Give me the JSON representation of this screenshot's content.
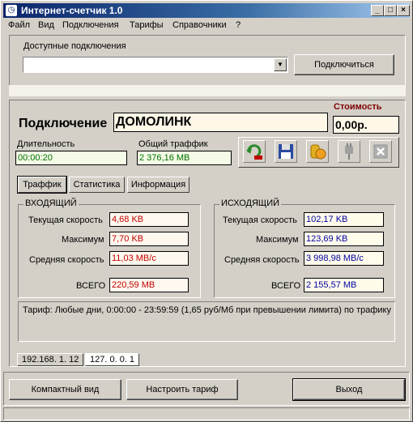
{
  "window": {
    "title": "Интернет-счетчик 1.0",
    "minimize": "_",
    "maximize": "□",
    "close": "×"
  },
  "menu": [
    "Файл",
    "Вид",
    "Подключения",
    "Тарифы",
    "Справочники",
    "?"
  ],
  "connections": {
    "label": "Доступные подключения",
    "selected": "",
    "connect_button": "Подключиться"
  },
  "connection": {
    "label": "Подключение",
    "name": "ДОМОЛИНК",
    "cost_label": "Стоимость",
    "cost_value": "0,00р.",
    "duration_label": "Длительность",
    "duration_value": "00:00:20",
    "total_label": "Общий траффик",
    "total_value": "2 376,16 MB"
  },
  "tabs": [
    "Траффик",
    "Статистика",
    "Информация"
  ],
  "incoming": {
    "title": "ВХОДЯЩИЙ",
    "current_label": "Текущая скорость",
    "current_value": "4,68 KB",
    "max_label": "Максимум",
    "max_value": "7,70 KB",
    "avg_label": "Средняя скорость",
    "avg_value": "11,03 MB/c",
    "total_label": "ВСЕГО",
    "total_value": "220,59 MB"
  },
  "outgoing": {
    "title": "ИСХОДЯЩИЙ",
    "current_label": "Текущая скорость",
    "current_value": "102,17 KB",
    "max_label": "Максимум",
    "max_value": "123,69 KB",
    "avg_label": "Средняя скорость",
    "avg_value": "3 998,98 MB/c",
    "total_label": "ВСЕГО",
    "total_value": "2 155,57 MB"
  },
  "tariff_text": "Тариф: Любые дни, 0:00:00 - 23:59:59 (1,65 руб/Мб при превышении лимита)  по трафику",
  "ip_tabs": [
    "192.168.  1. 12",
    "127.  0.  0.  1"
  ],
  "bottom_buttons": {
    "compact": "Компактный вид",
    "tariff": "Настроить тариф",
    "exit": "Выход"
  },
  "colors": {
    "green": "#007000",
    "red": "#c00000",
    "blue": "#0000a0",
    "cost": "#800000"
  }
}
